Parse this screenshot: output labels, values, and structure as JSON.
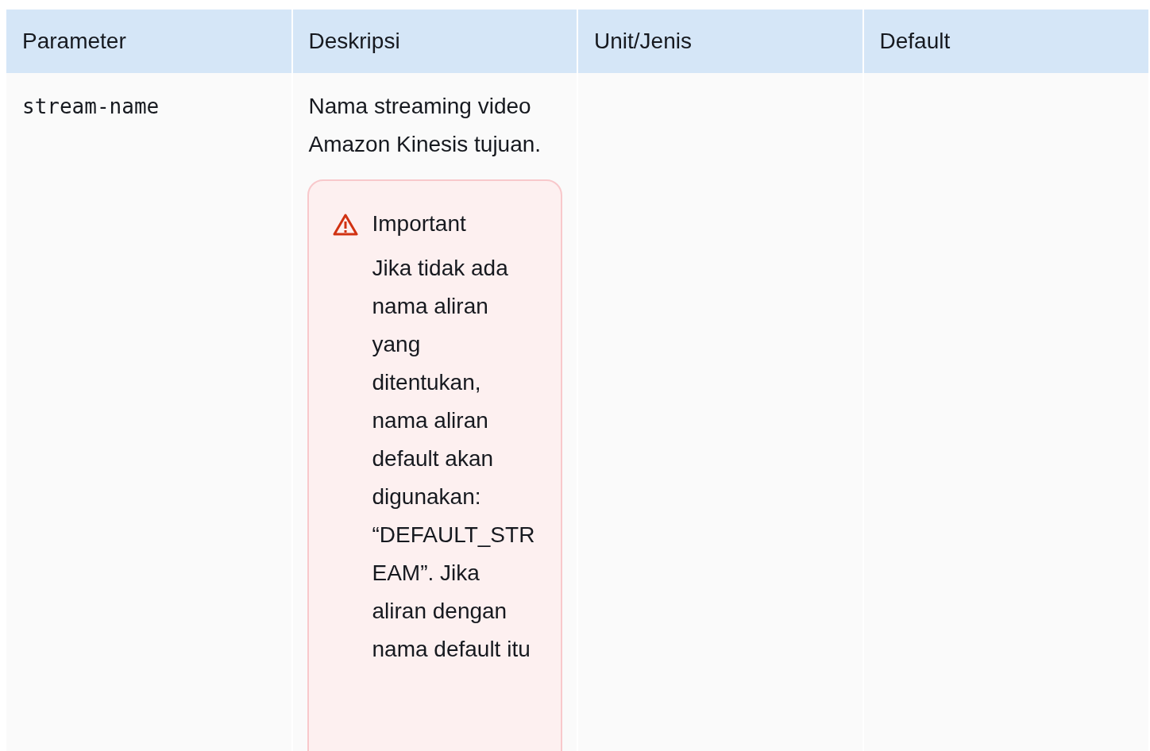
{
  "table": {
    "columns": [
      "Parameter",
      "Deskripsi",
      "Unit/Jenis",
      "Default"
    ],
    "rows": [
      {
        "parameter": "stream-name",
        "description": "Nama streaming video Amazon Kinesis tujuan.",
        "unit": "",
        "default": "",
        "callout": {
          "kind": "important",
          "title": "Important",
          "text": "Jika tidak ada nama aliran yang ditentukan, nama aliran default akan digunakan: “DEFAULT_STREAM”. Jika aliran dengan nama default itu"
        }
      }
    ]
  }
}
